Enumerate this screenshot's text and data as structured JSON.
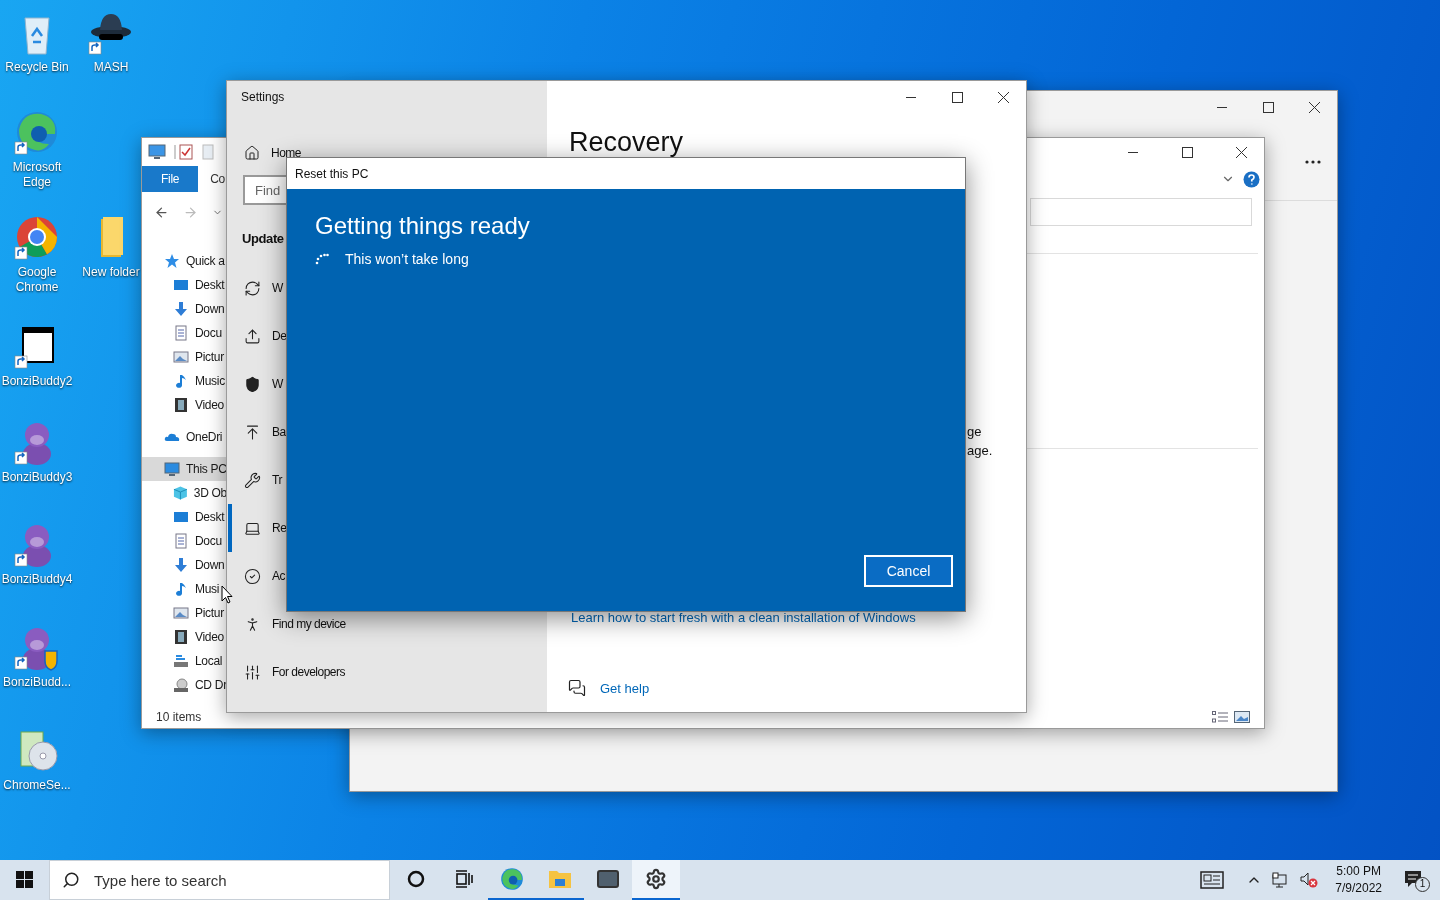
{
  "desktop": {
    "icons": [
      {
        "label": "Recycle Bin",
        "kind": "recycle",
        "shortcut": false
      },
      {
        "label": "MASH",
        "kind": "hat",
        "shortcut": true
      },
      {
        "label": "Microsoft Edge",
        "kind": "edge",
        "shortcut": true
      },
      {
        "label": "Google Chrome",
        "kind": "chrome",
        "shortcut": true
      },
      {
        "label": "New folder",
        "kind": "folder",
        "shortcut": false
      },
      {
        "label": "BonziBuddy2",
        "kind": "window",
        "shortcut": true
      },
      {
        "label": "BonziBuddy3",
        "kind": "figure",
        "shortcut": true
      },
      {
        "label": "BonziBuddy4",
        "kind": "figure",
        "shortcut": true
      },
      {
        "label": "BonziBudd...",
        "kind": "figure_shield",
        "shortcut": true
      },
      {
        "label": "ChromeSe...",
        "kind": "disc_box",
        "shortcut": false
      }
    ]
  },
  "explorer": {
    "ribbon_tabs": [
      {
        "label": "File",
        "kind": "file"
      },
      {
        "label": "Co",
        "kind": "tab"
      }
    ],
    "tree": [
      {
        "label": "Quick a",
        "kind": "star",
        "selected": false,
        "children": [
          {
            "label": "Deskt",
            "kind": "desktop",
            "selected": false
          },
          {
            "label": "Down",
            "kind": "download",
            "selected": false
          },
          {
            "label": "Docu",
            "kind": "document",
            "selected": false
          },
          {
            "label": "Pictur",
            "kind": "picture",
            "selected": false
          },
          {
            "label": "Music",
            "kind": "music",
            "selected": false
          },
          {
            "label": "Video",
            "kind": "video",
            "selected": false
          }
        ]
      },
      {
        "label": "OneDri",
        "kind": "cloud",
        "selected": false
      },
      {
        "label": "This PC",
        "kind": "pc",
        "selected": true,
        "children": [
          {
            "label": "3D Ob",
            "kind": "cube",
            "selected": false
          },
          {
            "label": "Deskt",
            "kind": "desktop",
            "selected": false
          },
          {
            "label": "Docu",
            "kind": "document",
            "selected": false
          },
          {
            "label": "Down",
            "kind": "download",
            "selected": false
          },
          {
            "label": "Musi",
            "kind": "music",
            "selected": false
          },
          {
            "label": "Pictur",
            "kind": "picture",
            "selected": false
          },
          {
            "label": "Video",
            "kind": "video",
            "selected": false
          },
          {
            "label": "Local",
            "kind": "drive",
            "selected": false
          },
          {
            "label": "CD Dr",
            "kind": "disc",
            "selected": false
          }
        ]
      }
    ],
    "status": "10 items"
  },
  "settings": {
    "title": "Settings",
    "home": "Home",
    "search": {
      "placeholder": "Find"
    },
    "section": "Update",
    "nav": [
      {
        "label": "W",
        "kind": "sync",
        "selected": false
      },
      {
        "label": "De",
        "kind": "delivery",
        "selected": false
      },
      {
        "label": "W",
        "kind": "shield",
        "selected": false
      },
      {
        "label": "Ba",
        "kind": "backup",
        "selected": false
      },
      {
        "label": "Tr",
        "kind": "wrench",
        "selected": false
      },
      {
        "label": "Re",
        "kind": "recovery",
        "selected": true
      },
      {
        "label": "Ac",
        "kind": "check",
        "selected": false
      },
      {
        "label": "Find my device",
        "kind": "locate",
        "selected": false
      },
      {
        "label": "For developers",
        "kind": "tools",
        "selected": false
      }
    ],
    "page_title": "Recovery",
    "fragments": [
      "ge",
      "age."
    ],
    "link": "Learn how to start fresh with a clean installation of Windows",
    "help": "Get help"
  },
  "dialog": {
    "title": "Reset this PC",
    "heading": "Getting things ready",
    "status": "This won’t take long",
    "button": "Cancel"
  },
  "taskbar": {
    "search": {
      "placeholder": "Type here to search"
    },
    "apps": [
      {
        "kind": "cortana",
        "running": false,
        "selected": false
      },
      {
        "kind": "taskview",
        "running": false,
        "selected": false
      },
      {
        "kind": "edge",
        "running": true,
        "selected": false
      },
      {
        "kind": "explorer",
        "running": true,
        "selected": false
      },
      {
        "kind": "mail",
        "running": false,
        "selected": false
      },
      {
        "kind": "settings",
        "running": true,
        "selected": true
      }
    ],
    "time": "5:00 PM",
    "date": "7/9/2022",
    "notifications": "1"
  }
}
